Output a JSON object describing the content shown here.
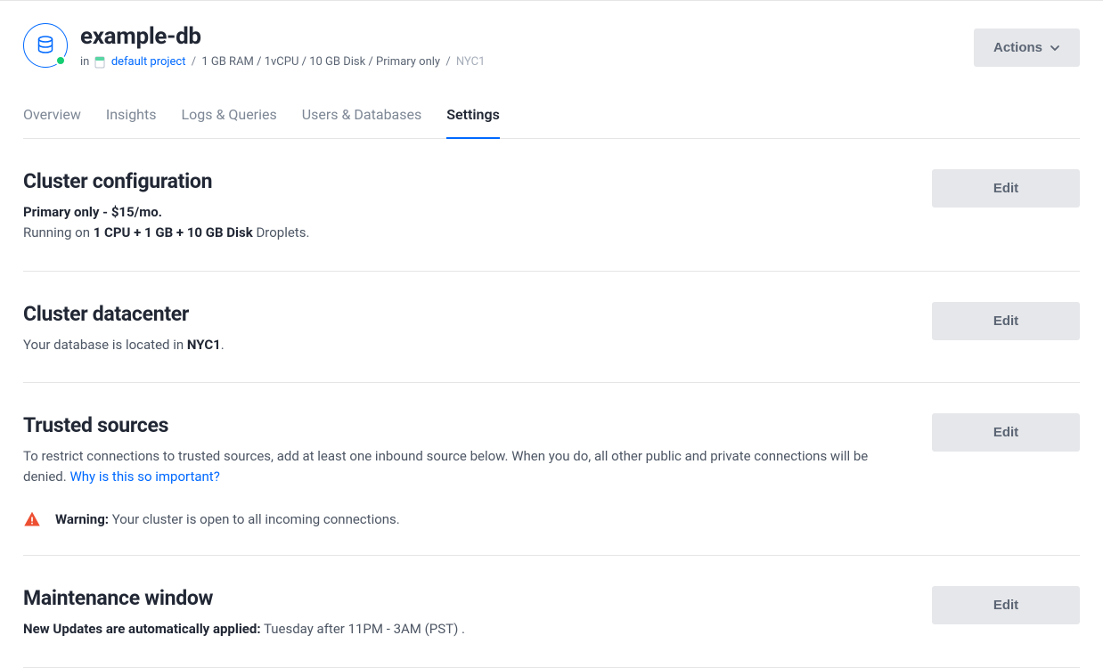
{
  "header": {
    "title": "example-db",
    "breadcrumb": {
      "in_label": "in",
      "project_name": "default project",
      "specs": "1 GB RAM / 1vCPU / 10 GB Disk / Primary only",
      "region": "NYC1"
    },
    "actions_label": "Actions"
  },
  "tabs": {
    "overview": "Overview",
    "insights": "Insights",
    "logs": "Logs & Queries",
    "users": "Users & Databases",
    "settings": "Settings"
  },
  "sections": {
    "cluster_config": {
      "title": "Cluster configuration",
      "plan": "Primary only - $15/mo.",
      "running_prefix": "Running on ",
      "running_bold": "1 CPU + 1 GB + 10 GB Disk",
      "running_suffix": " Droplets.",
      "edit_label": "Edit"
    },
    "cluster_datacenter": {
      "title": "Cluster datacenter",
      "prefix": "Your database is located in ",
      "location": "NYC1",
      "suffix": ".",
      "edit_label": "Edit"
    },
    "trusted_sources": {
      "title": "Trusted sources",
      "desc": "To restrict connections to trusted sources, add at least one inbound source below. When you do, all other public and private connections will be denied. ",
      "link_label": "Why is this so important?",
      "warning_label": "Warning:",
      "warning_text": " Your cluster is open to all incoming connections.",
      "edit_label": "Edit"
    },
    "maintenance": {
      "title": "Maintenance window",
      "label": "New Updates are automatically applied:",
      "value": " Tuesday after 11PM - 3AM (PST) .",
      "edit_label": "Edit"
    }
  }
}
